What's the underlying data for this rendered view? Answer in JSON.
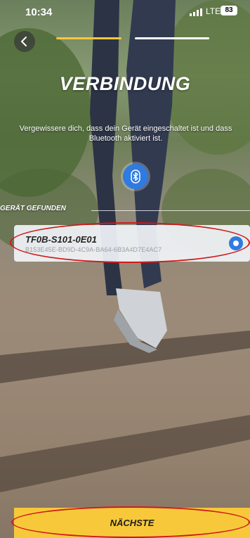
{
  "status_bar": {
    "time": "10:34",
    "network": "LTE",
    "battery": "83"
  },
  "progress": {
    "steps_total": 2,
    "current_step": 1
  },
  "screen": {
    "title": "VERBINDUNG",
    "subtitle": "Vergewissere dich, dass dein Gerät eingeschaltet ist und dass Bluetooth aktiviert ist."
  },
  "devices": {
    "section_label": "GERÄT GEFUNDEN",
    "items": [
      {
        "name": "TF0B-S101-0E01",
        "uuid": "B153E45E-BD9D-4C9A-BA64-6B3A4D7E4AC7",
        "selected": true
      }
    ]
  },
  "footer": {
    "next_label": "NÄCHSTE"
  },
  "colors": {
    "accent_yellow": "#f7c93a",
    "bluetooth_blue": "#2f7be0",
    "annotation_red": "#d01a1a"
  },
  "icons": [
    "back-arrow-icon",
    "bluetooth-icon",
    "signal-icon",
    "radio-selected-icon"
  ]
}
